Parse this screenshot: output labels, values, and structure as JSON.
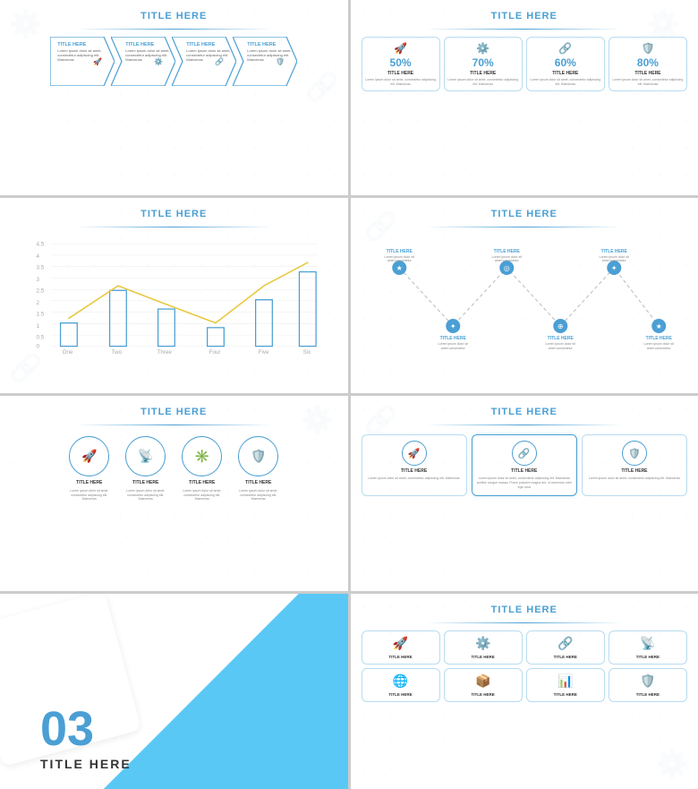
{
  "slides": {
    "s1": {
      "title": "TITLE HERE",
      "arrows": [
        {
          "label": "TITLE HERE",
          "text": "Lorem ipsum dolor sit amet, consectetur adipiscing elit. Maecenas"
        },
        {
          "label": "TITLE HERE",
          "text": "Lorem ipsum dolor sit amet, consectetur adipiscing elit. Maecenas"
        },
        {
          "label": "TITLE HERE",
          "text": "Lorem ipsum dolor sit amet, consectetur adipiscing elit. Maecenas"
        },
        {
          "label": "TITLE HERE",
          "text": "Lorem ipsum dolor sit amet, consectetur adipiscing elit. Maecenas"
        }
      ]
    },
    "s2": {
      "title": "TITLE HERE",
      "stats": [
        {
          "percent": "50%",
          "icon": "🚀",
          "title": "TITLE HERE",
          "desc": "Lorem ipsum dolor sit amet, consectetur adipiscing elit. Maecenas"
        },
        {
          "percent": "70%",
          "icon": "⚙️",
          "title": "TITLE HERE",
          "desc": "Lorem ipsum dolor sit amet, consectetur adipiscing elit. Maecenas"
        },
        {
          "percent": "60%",
          "icon": "🔗",
          "title": "TITLE HERE",
          "desc": "Lorem ipsum dolor sit amet, consectetur adipiscing elit. Maecenas"
        },
        {
          "percent": "80%",
          "icon": "🛡️",
          "title": "TITLE HERE",
          "desc": "Lorem ipsum dolor sit amet, consectetur adipiscing elit. Maecenas"
        }
      ]
    },
    "s3": {
      "title": "TITLE HERE",
      "labels": [
        "One",
        "Two",
        "Three",
        "Four",
        "Five",
        "Six"
      ],
      "y_labels": [
        "4.5",
        "4",
        "3.5",
        "3",
        "2.5",
        "2",
        "1.5",
        "1",
        "0.5",
        "0"
      ]
    },
    "s4": {
      "title": "TITLE HERE",
      "nodes": [
        {
          "label": "TITLE HERE",
          "text": "Lorem ipsum dolor sit amet, consectetur congue mass. Fusce posuere"
        },
        {
          "label": "TITLE HERE",
          "text": "Lorem ipsum dolor sit amet, consectetur adipiscing elit. Maecenas portitor"
        },
        {
          "label": "TITLE HERE",
          "text": "Lorem ipsum dolor sit amet, consectetur adipiscing elit. Maecenas portitor"
        },
        {
          "label": "TITLE HERE",
          "text": "Lorem ipsum dolor sit amet, consectetur adipiscing elit. Maecenas portitor"
        },
        {
          "label": "TITLE HERE",
          "text": "Lorem ipsum dolor sit amet, consectetur adipiscing elit. Maecenas portitor"
        },
        {
          "label": "TITLE HERE",
          "text": "Lorem ipsum dolor sit amet, consectetur adipiscing elit. Maecenas portitor"
        }
      ]
    },
    "s5": {
      "title": "TITLE HERE",
      "circles": [
        {
          "icon": "🚀",
          "label": "TITLE HERE",
          "desc": "Lorem ipsum dolor sit amet, consectetur adipiscing elit. Maecenas"
        },
        {
          "icon": "📡",
          "label": "TITLE HERE",
          "desc": "Lorem ipsum dolor sit amet, consectetur adipiscing elit. Maecenas"
        },
        {
          "icon": "✳️",
          "label": "TITLE HERE",
          "desc": "Lorem ipsum dolor sit amet, consectetur adipiscing elit. Maecenas"
        },
        {
          "icon": "🛡️",
          "label": "TITLE HERE",
          "desc": "Lorem ipsum dolor sit amet, consectetur adipiscing elit. Maecenas"
        }
      ]
    },
    "s6": {
      "title": "TITLE HERE",
      "cards": [
        {
          "icon": "🚀",
          "title": "TITLE HERE",
          "desc": "Lorem ipsum dolor sit amet, consectetur adipiscing elit. Maecenas"
        },
        {
          "icon": "🔗",
          "title": "TITLE HERE",
          "desc": "Lorem ipsum dolor sit amet, consectetur adipiscing elit. Maecenas portitor congue massa. Fusce posuere magna dui, ut commodo nibh egis urna"
        },
        {
          "icon": "🛡️",
          "title": "TITLE HERE",
          "desc": "Lorem ipsum dolor sit amet, consectetur adipiscing elit. Maecenas"
        }
      ]
    },
    "s7": {
      "number": "03",
      "title": "TITLE HERE"
    },
    "s8": {
      "title": "TITLE HERE",
      "items": [
        {
          "icon": "🚀",
          "label": "TITLE HERE"
        },
        {
          "icon": "⚙️",
          "label": "TITLE HERE"
        },
        {
          "icon": "🔗",
          "label": "TITLE HERE"
        },
        {
          "icon": "📡",
          "label": "TITLE HERE"
        },
        {
          "icon": "🌐",
          "label": "TITLE HERE"
        },
        {
          "icon": "📦",
          "label": "TITLE HERE"
        },
        {
          "icon": "📊",
          "label": "TITLE HERE"
        },
        {
          "icon": "🛡️",
          "label": "TITLE HERE"
        }
      ]
    }
  },
  "accent_color": "#4a9fd4",
  "text_color": "#333333",
  "light_blue": "#b8dcf0"
}
